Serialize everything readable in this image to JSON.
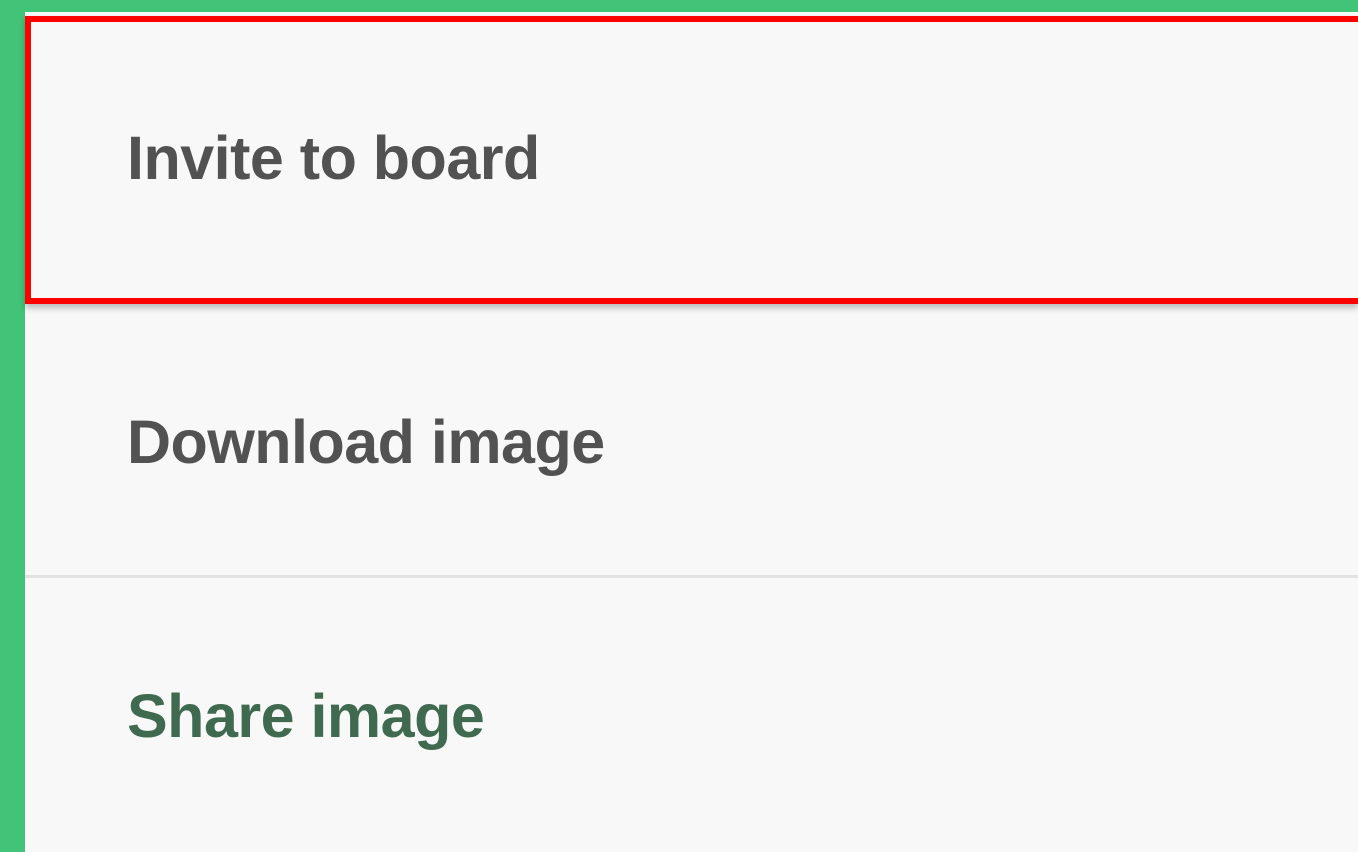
{
  "menu": {
    "items": [
      {
        "label": "Invite to board",
        "highlighted": true
      },
      {
        "label": "Download image",
        "highlighted": false
      },
      {
        "label": "Share image",
        "highlighted": false
      }
    ]
  },
  "colors": {
    "background": "#41c478",
    "panel": "#f8f8f8",
    "label": "#525252",
    "share_label": "#3f6a50",
    "highlight": "#ff0000",
    "divider": "#e2e2e2"
  }
}
